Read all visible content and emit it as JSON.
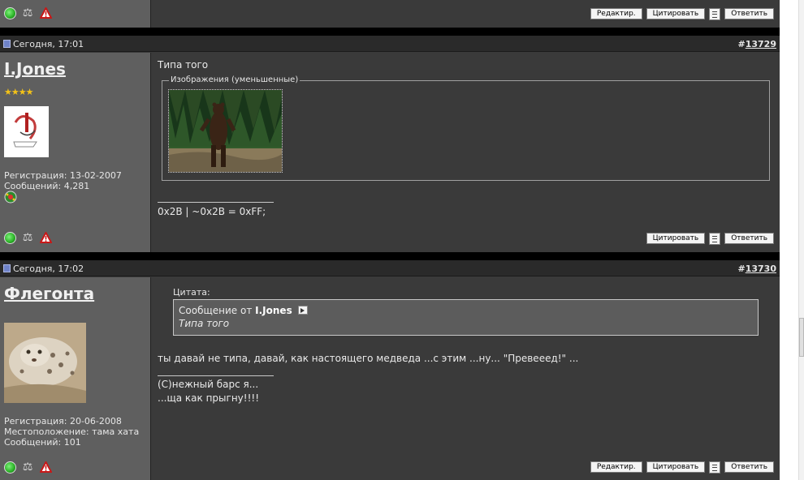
{
  "posts": [
    {
      "buttons": {
        "edit": "Редактир.",
        "quote": "Цитировать",
        "reply": "Ответить"
      }
    },
    {
      "date": "Сегодня, 17:01",
      "post_link_hash": "#",
      "post_number": "13729",
      "username": "I.Jones",
      "stars": "★★★★",
      "info": [
        "Регистрация: 13-02-2007",
        "Сообщений: 4,281"
      ],
      "message": "Типа того",
      "images_legend": "Изображения (уменьшенные)",
      "signature": "0x2B | ~0x2B = 0xFF;",
      "buttons": {
        "quote": "Цитировать",
        "reply": "Ответить"
      }
    },
    {
      "date": "Сегодня, 17:02",
      "post_link_hash": "#",
      "post_number": "13730",
      "username": "Флегонта",
      "info": [
        "Регистрация: 20-06-2008",
        "Местоположение: тама хата",
        "Сообщений: 101"
      ],
      "quote_label": "Цитата:",
      "quote_from_prefix": "Сообщение от",
      "quote_author": "I.Jones",
      "quote_text": "Типа того",
      "message": "ты давай не типа, давай, как настоящего медведа ...с этим ...ну... \"Превееед!\" ...",
      "signature_lines": [
        "(С)нежный барс я...",
        "...ща как прыгну!!!!"
      ],
      "buttons": {
        "edit": "Редактир.",
        "quote": "Цитировать",
        "reply": "Ответить"
      }
    }
  ],
  "icons": {
    "online": "online-status-icon",
    "scales": "reputation-scales-icon",
    "warn": "report-warning-icon",
    "multiquote": "multiquote-icon",
    "award": "award-icon",
    "page": "post-page-icon"
  },
  "colors": {
    "sidebar": "#5f5f5f",
    "content": "#3a3a3a",
    "header": "#2a2a2a",
    "stars": "#f3c218"
  }
}
